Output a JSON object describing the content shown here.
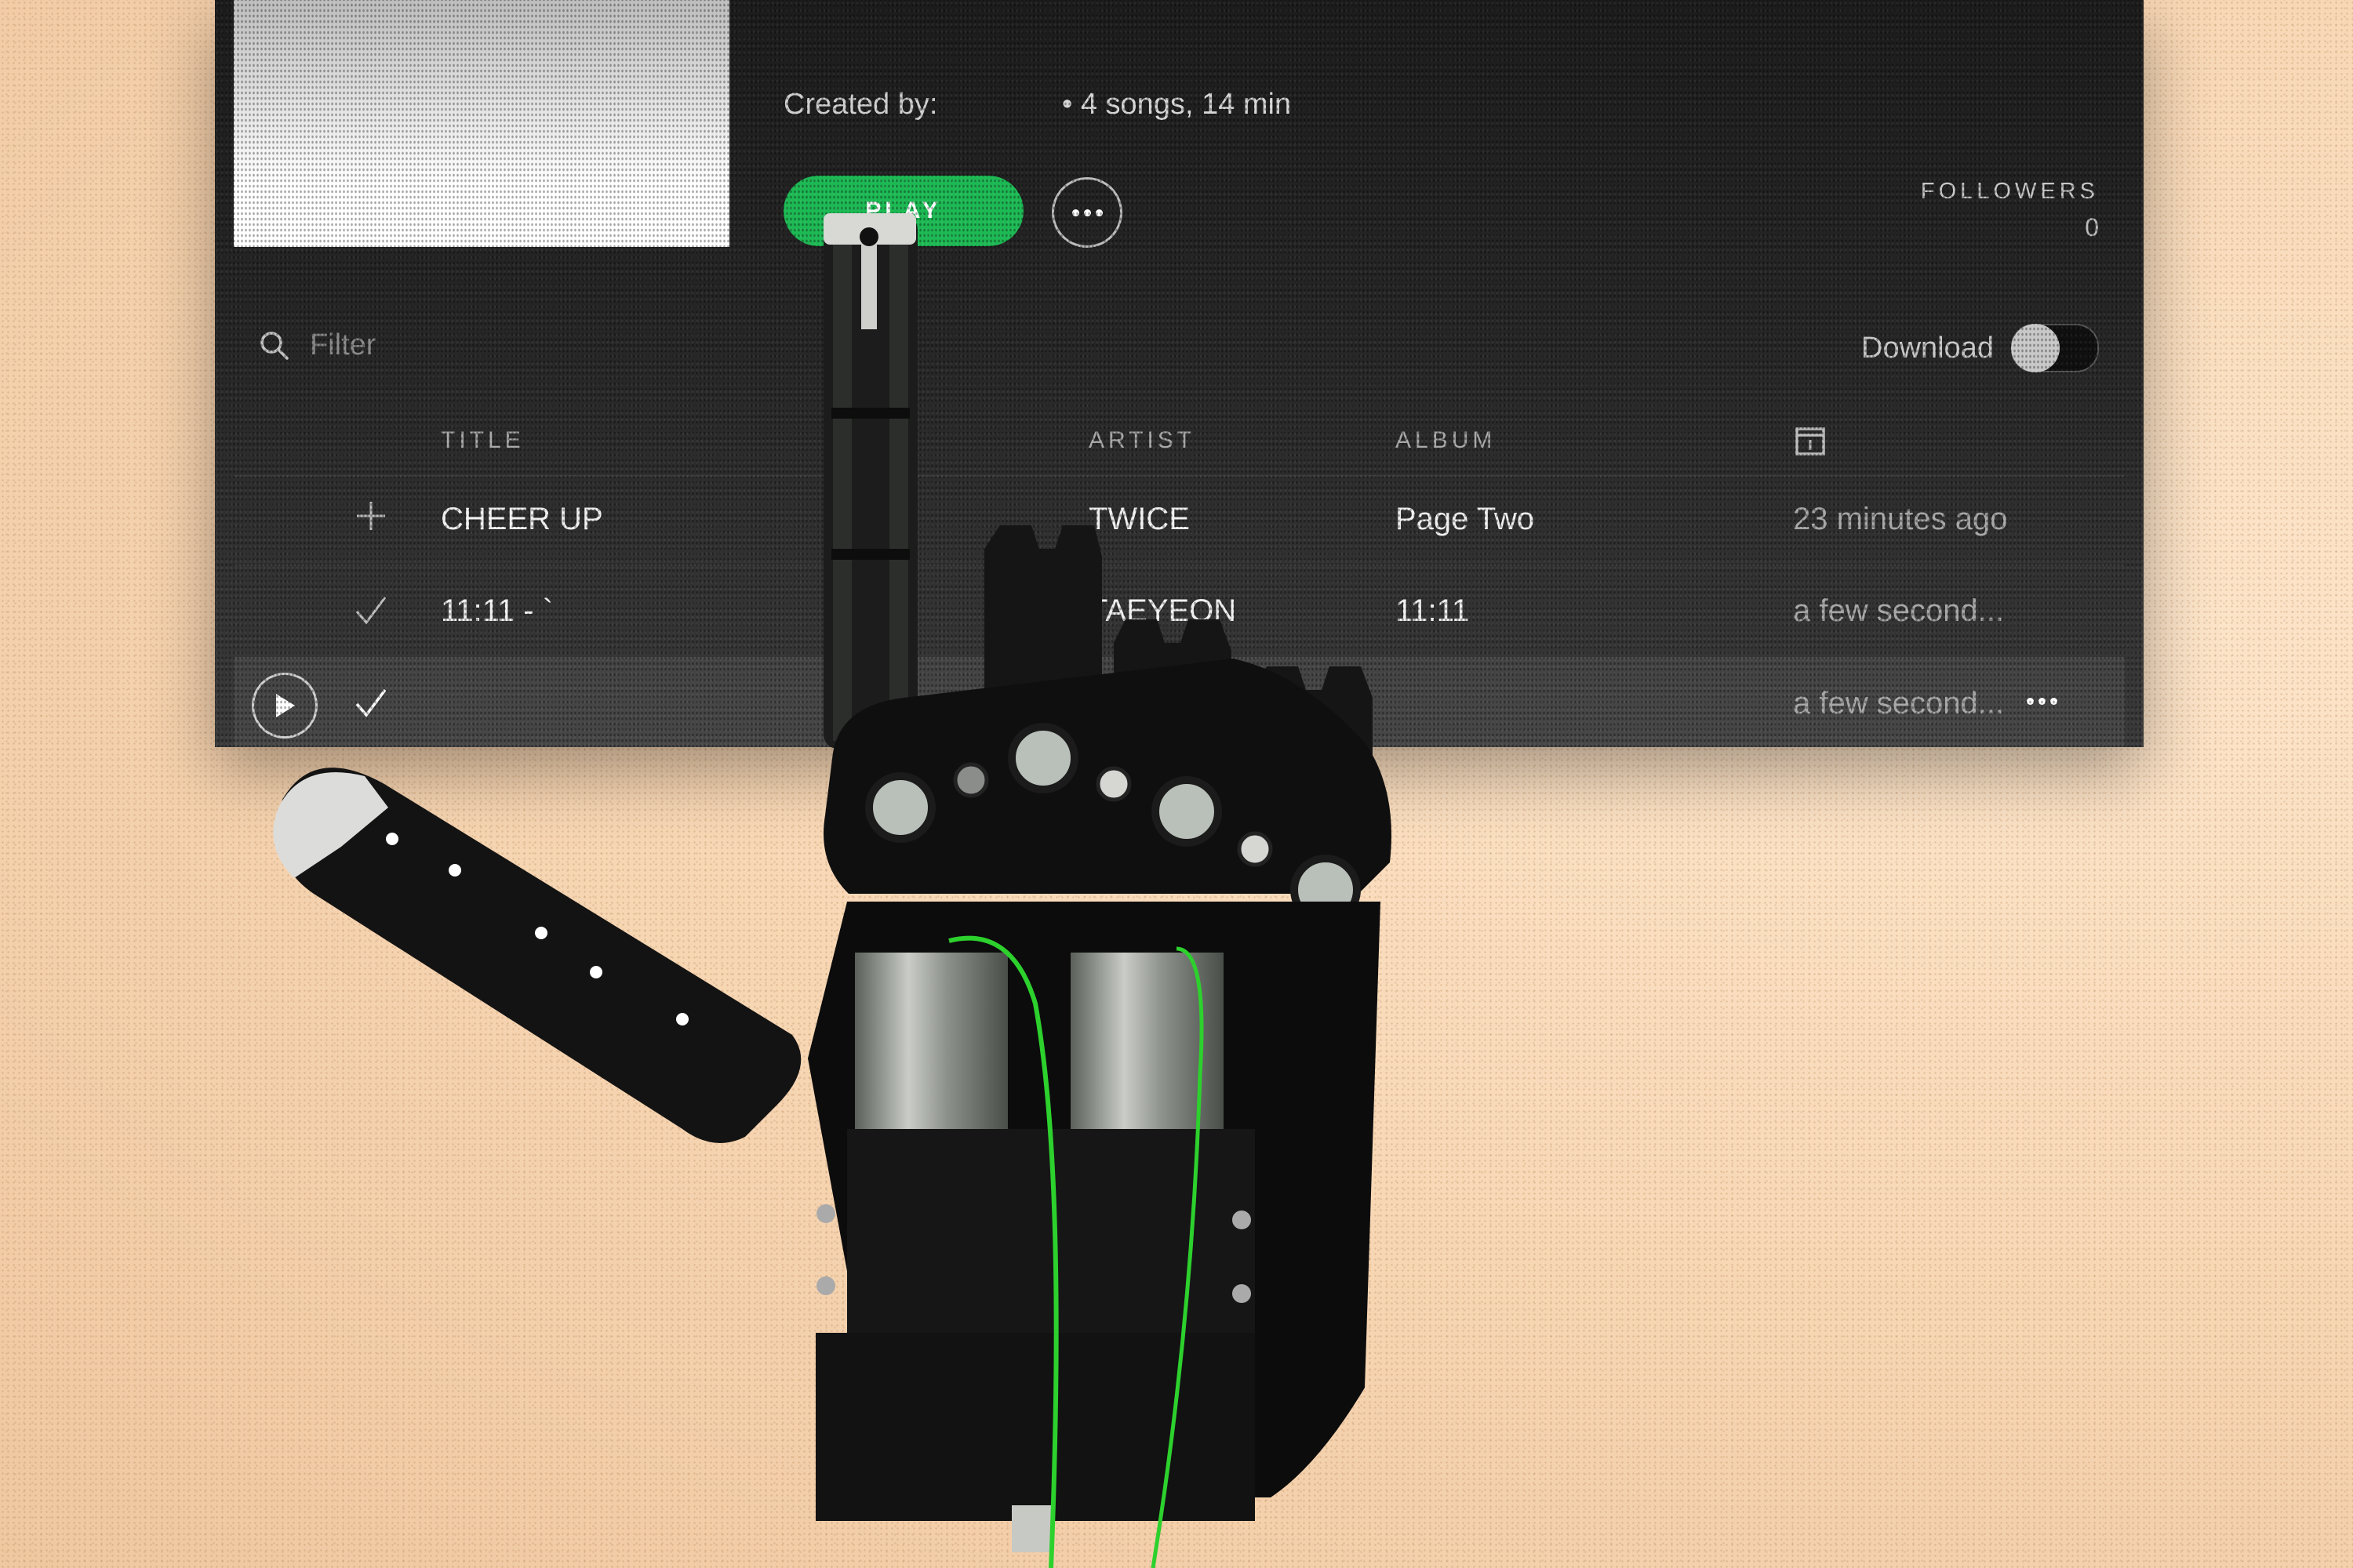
{
  "playlist": {
    "created_by_label": "Created by:",
    "summary": "• 4 songs, 14 min",
    "play_label": "PLAY",
    "followers_label": "FOLLOWERS",
    "followers_count": "0"
  },
  "filter": {
    "placeholder": "Filter"
  },
  "download": {
    "label": "Download",
    "enabled": false
  },
  "table": {
    "headers": {
      "title": "TITLE",
      "artist": "ARTIST",
      "album": "ALBUM",
      "date_icon": "calendar-icon"
    },
    "rows": [
      {
        "status_icon": "plus-icon",
        "title": "CHEER UP",
        "artist": "TWICE",
        "album": "Page Two",
        "added": "23 minutes ago"
      },
      {
        "status_icon": "check-icon",
        "title": "11:11 - `",
        "artist": "TAEYEON",
        "album": "11:11",
        "added": "a few second..."
      },
      {
        "status_icon": "check-icon",
        "title": "",
        "artist": "",
        "album": "",
        "added": "a few second...",
        "highlighted": true
      }
    ]
  },
  "colors": {
    "accent": "#1db954",
    "panel": "#262626",
    "background": "#f8d8b6"
  }
}
